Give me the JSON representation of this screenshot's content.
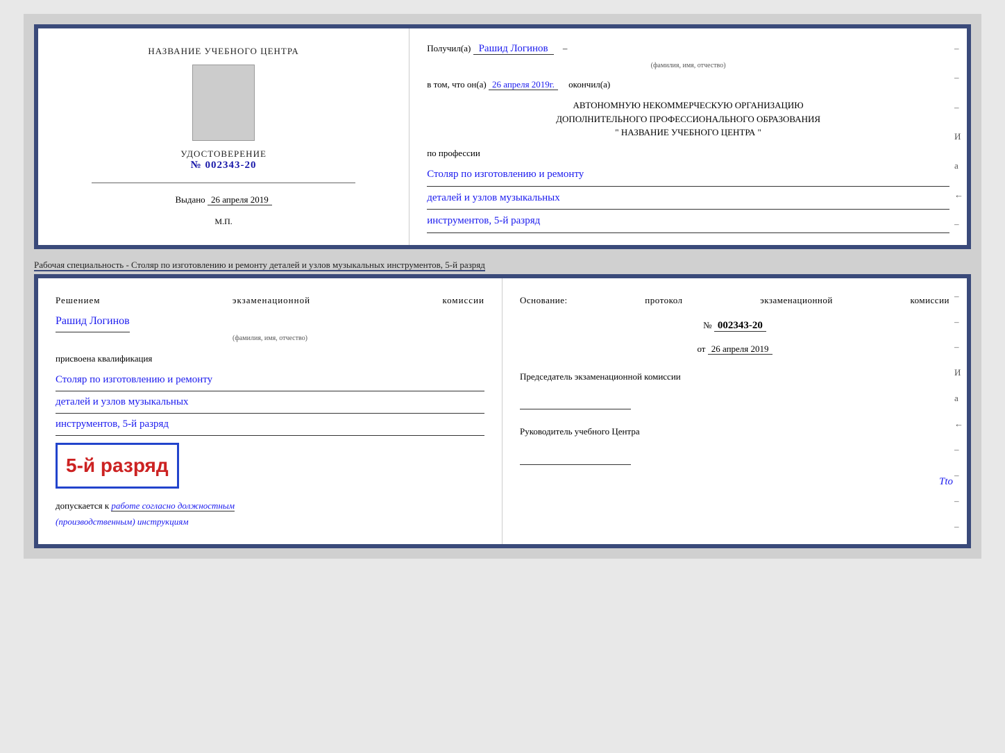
{
  "cert1": {
    "left": {
      "training_center_label": "НАЗВАНИЕ УЧЕБНОГО ЦЕНТРА",
      "cert_title": "УДОСТОВЕРЕНИЕ",
      "cert_number_prefix": "№",
      "cert_number": "002343-20",
      "issued_label": "Выдано",
      "issued_date": "26 апреля 2019",
      "mp_label": "М.П."
    },
    "right": {
      "received_label": "Получил(а)",
      "recipient_name": "Рашид Логинов",
      "fio_hint": "(фамилия, имя, отчество)",
      "date_label": "в том, что он(а)",
      "date_value": "26 апреля 2019г.",
      "finished_label": "окончил(а)",
      "org_line1": "АВТОНОМНУЮ НЕКОММЕРЧЕСКУЮ ОРГАНИЗАЦИЮ",
      "org_line2": "ДОПОЛНИТЕЛЬНОГО ПРОФЕССИОНАЛЬНОГО ОБРАЗОВАНИЯ",
      "org_line3": "\"  НАЗВАНИЕ УЧЕБНОГО ЦЕНТРА  \"",
      "profession_label": "по профессии",
      "profession_line1": "Столяр по изготовлению и ремонту",
      "profession_line2": "деталей и узлов музыкальных",
      "profession_line3": "инструментов, 5-й разряд",
      "side_dashes": [
        "-",
        "-",
        "-",
        "И",
        "а",
        "←",
        "-"
      ]
    }
  },
  "specialty_label": {
    "prefix": "Рабочая специальность - ",
    "underlined": "Столяр по изготовлению и ремонту деталей и узлов музыкальных инструментов, 5-й разряд"
  },
  "cert2": {
    "left": {
      "decision_text": "Решением экзаменационной комиссии",
      "name_value": "Рашид Логинов",
      "fio_hint": "(фамилия, имя, отчество)",
      "qualification_label": "присвоена квалификация",
      "qual_line1": "Столяр по изготовлению и ремонту",
      "qual_line2": "деталей и узлов музыкальных",
      "qual_line3": "инструментов, 5-й разряд",
      "badge_text": "5-й разряд",
      "допускается_prefix": "допускается к",
      "допускается_value": "работе согласно должностным",
      "допускается_line2": "(производственным) инструкциям"
    },
    "right": {
      "basis_label": "Основание: протокол экзаменационной комиссии",
      "protocol_prefix": "№",
      "protocol_number": "002343-20",
      "date_prefix": "от",
      "date_value": "26 апреля 2019",
      "chairman_label": "Председатель экзаменационной комиссии",
      "head_label": "Руководитель учебного Центра",
      "side_dashes": [
        "-",
        "-",
        "-",
        "И",
        "а",
        "←",
        "-",
        "-",
        "-",
        "-"
      ]
    }
  },
  "tto_text": "Tto"
}
